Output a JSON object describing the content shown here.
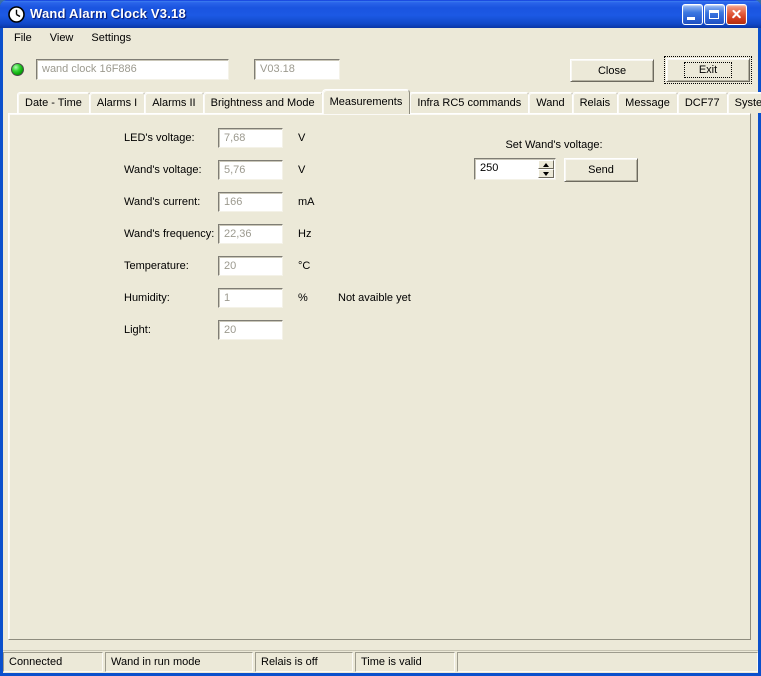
{
  "window": {
    "title": "Wand Alarm Clock V3.18"
  },
  "icons": {
    "app": "clock-icon",
    "minimize": "minimize-icon",
    "maximize": "maximize-icon",
    "close": "close-icon",
    "led": "green-led-indicator",
    "spin_up": "spin-up-arrow",
    "spin_down": "spin-down-arrow",
    "resize": "resize-grip"
  },
  "menu": {
    "file": "File",
    "view": "View",
    "settings": "Settings"
  },
  "toolbar": {
    "device_name": "wand clock 16F886",
    "version": "V03.18",
    "close_button": "Close",
    "exit_button": "Exit"
  },
  "tabs": {
    "items": [
      "Date - Time",
      "Alarms I",
      "Alarms II",
      "Brightness and Mode",
      "Measurements",
      "Infra RC5 commands",
      "Wand",
      "Relais",
      "Message",
      "DCF77",
      "System"
    ],
    "active": "Measurements"
  },
  "measurements": {
    "rows": [
      {
        "label": "LED's voltage:",
        "value": "7,68",
        "unit": "V"
      },
      {
        "label": "Wand's voltage:",
        "value": "5,76",
        "unit": "V"
      },
      {
        "label": "Wand's current:",
        "value": "166",
        "unit": "mA"
      },
      {
        "label": "Wand's frequency:",
        "value": "22,36",
        "unit": "Hz"
      },
      {
        "label": "Temperature:",
        "value": "20",
        "unit": "°C"
      },
      {
        "label": "Humidity:",
        "value": "1",
        "unit": "%",
        "note": "Not avaible yet"
      },
      {
        "label": "Light:",
        "value": "20",
        "unit": ""
      }
    ],
    "set_wand_voltage": {
      "label": "Set Wand's voltage:",
      "value": "250",
      "send_button": "Send"
    }
  },
  "statusbar": {
    "panels": [
      "Connected",
      "Wand in run mode",
      "Relais is off",
      "Time is valid",
      ""
    ]
  }
}
